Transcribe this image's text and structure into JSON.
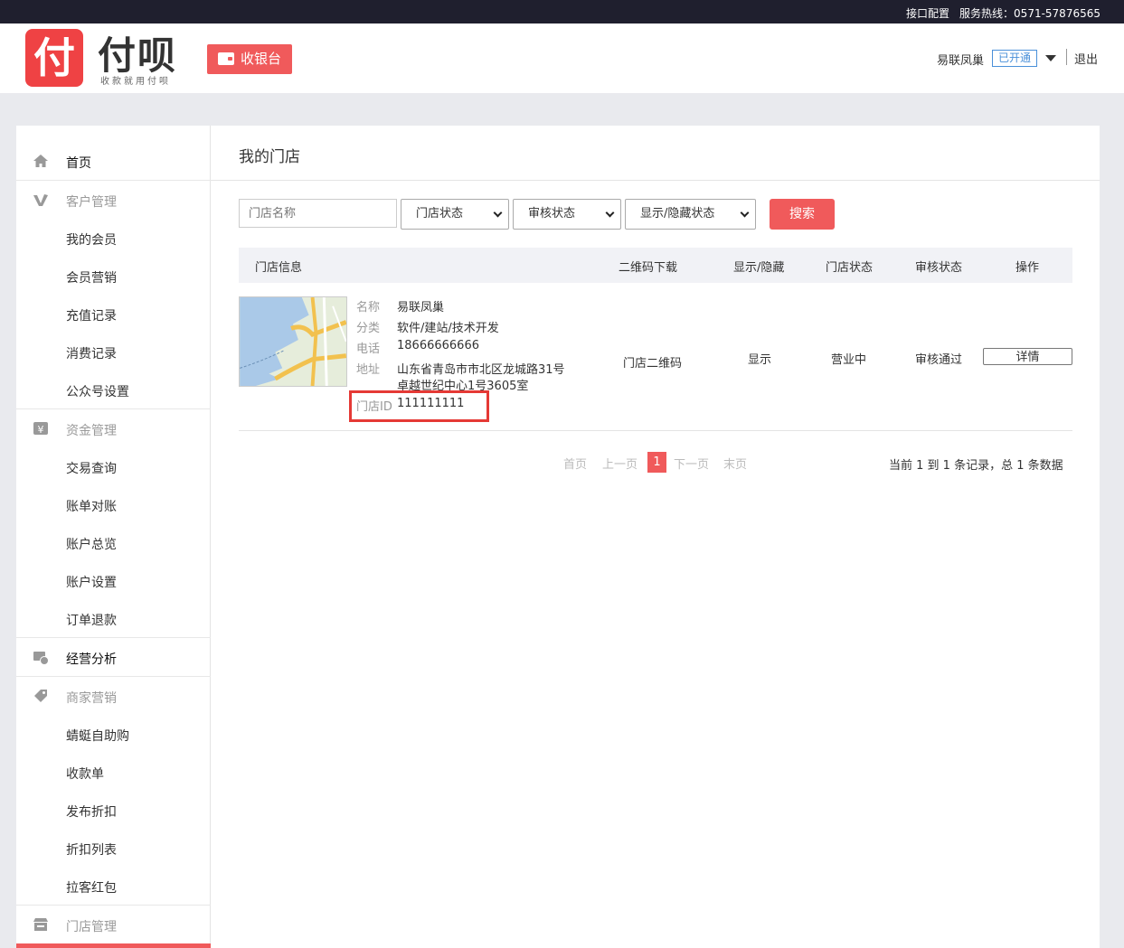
{
  "topbar": {
    "api_link": "接口配置",
    "hotline": "服务热线：0571-57876565"
  },
  "header": {
    "logo_mark": "付",
    "logo_text": "付呗",
    "slogan": "收款就用付呗",
    "cashier_label": "收银台",
    "user_name": "易联凤巢",
    "status_badge": "已开通",
    "logout_label": "退出"
  },
  "sidebar": {
    "items": [
      {
        "label": "首页",
        "type": "top"
      },
      {
        "label": "客户管理",
        "type": "section"
      },
      {
        "label": "我的会员",
        "type": "sub"
      },
      {
        "label": "会员营销",
        "type": "sub"
      },
      {
        "label": "充值记录",
        "type": "sub"
      },
      {
        "label": "消费记录",
        "type": "sub"
      },
      {
        "label": "公众号设置",
        "type": "sub"
      },
      {
        "label": "资金管理",
        "type": "section"
      },
      {
        "label": "交易查询",
        "type": "sub"
      },
      {
        "label": "账单对账",
        "type": "sub"
      },
      {
        "label": "账户总览",
        "type": "sub"
      },
      {
        "label": "账户设置",
        "type": "sub"
      },
      {
        "label": "订单退款",
        "type": "sub"
      },
      {
        "label": "经营分析",
        "type": "top"
      },
      {
        "label": "商家营销",
        "type": "section"
      },
      {
        "label": "蜻蜓自助购",
        "type": "sub"
      },
      {
        "label": "收款单",
        "type": "sub"
      },
      {
        "label": "发布折扣",
        "type": "sub"
      },
      {
        "label": "折扣列表",
        "type": "sub"
      },
      {
        "label": "拉客红包",
        "type": "sub"
      },
      {
        "label": "门店管理",
        "type": "section"
      }
    ]
  },
  "main": {
    "title": "我的门店",
    "filters": {
      "name_placeholder": "门店名称",
      "store_status": "门店状态",
      "review_status": "审核状态",
      "visibility_status": "显示/隐藏状态",
      "search_label": "搜索"
    },
    "table": {
      "headers": [
        "门店信息",
        "二维码下载",
        "显示/隐藏",
        "门店状态",
        "审核状态",
        "操作"
      ],
      "rows": [
        {
          "name_label": "名称",
          "name": "易联凤巢",
          "category_label": "分类",
          "category": "软件/建站/技术开发",
          "phone_label": "电话",
          "phone": "18666666666",
          "address_label": "地址",
          "address_line1": "山东省青岛市市北区龙城路31号",
          "address_line2": "卓越世纪中心1号3605室",
          "id_label": "门店ID",
          "store_id": "111111111",
          "qr_download": "门店二维码",
          "visibility": "显示",
          "store_status": "营业中",
          "review_status": "审核通过",
          "action": "详情"
        }
      ]
    },
    "pagination": {
      "first": "首页",
      "prev": "上一页",
      "current": "1",
      "next": "下一页",
      "last": "末页",
      "summary": "当前 1 到 1 条记录，总 1 条数据"
    }
  }
}
